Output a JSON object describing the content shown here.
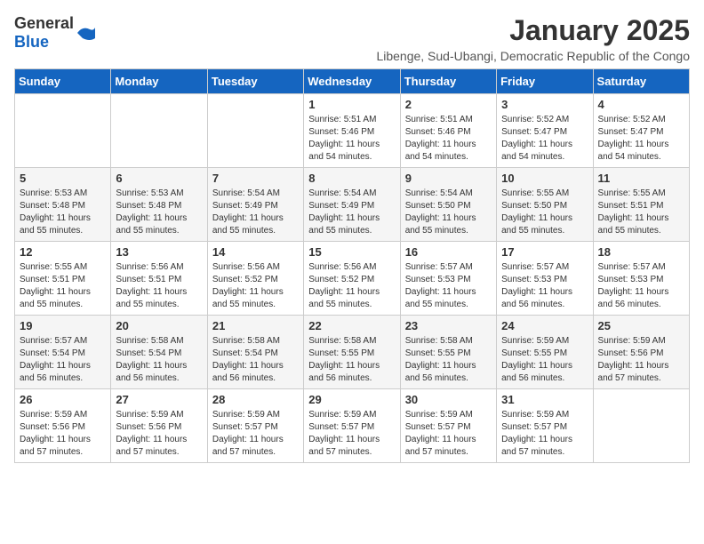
{
  "logo": {
    "general": "General",
    "blue": "Blue"
  },
  "title": "January 2025",
  "subtitle": "Libenge, Sud-Ubangi, Democratic Republic of the Congo",
  "headers": [
    "Sunday",
    "Monday",
    "Tuesday",
    "Wednesday",
    "Thursday",
    "Friday",
    "Saturday"
  ],
  "weeks": [
    [
      {
        "day": "",
        "info": ""
      },
      {
        "day": "",
        "info": ""
      },
      {
        "day": "",
        "info": ""
      },
      {
        "day": "1",
        "info": "Sunrise: 5:51 AM\nSunset: 5:46 PM\nDaylight: 11 hours and 54 minutes."
      },
      {
        "day": "2",
        "info": "Sunrise: 5:51 AM\nSunset: 5:46 PM\nDaylight: 11 hours and 54 minutes."
      },
      {
        "day": "3",
        "info": "Sunrise: 5:52 AM\nSunset: 5:47 PM\nDaylight: 11 hours and 54 minutes."
      },
      {
        "day": "4",
        "info": "Sunrise: 5:52 AM\nSunset: 5:47 PM\nDaylight: 11 hours and 54 minutes."
      }
    ],
    [
      {
        "day": "5",
        "info": "Sunrise: 5:53 AM\nSunset: 5:48 PM\nDaylight: 11 hours and 55 minutes."
      },
      {
        "day": "6",
        "info": "Sunrise: 5:53 AM\nSunset: 5:48 PM\nDaylight: 11 hours and 55 minutes."
      },
      {
        "day": "7",
        "info": "Sunrise: 5:54 AM\nSunset: 5:49 PM\nDaylight: 11 hours and 55 minutes."
      },
      {
        "day": "8",
        "info": "Sunrise: 5:54 AM\nSunset: 5:49 PM\nDaylight: 11 hours and 55 minutes."
      },
      {
        "day": "9",
        "info": "Sunrise: 5:54 AM\nSunset: 5:50 PM\nDaylight: 11 hours and 55 minutes."
      },
      {
        "day": "10",
        "info": "Sunrise: 5:55 AM\nSunset: 5:50 PM\nDaylight: 11 hours and 55 minutes."
      },
      {
        "day": "11",
        "info": "Sunrise: 5:55 AM\nSunset: 5:51 PM\nDaylight: 11 hours and 55 minutes."
      }
    ],
    [
      {
        "day": "12",
        "info": "Sunrise: 5:55 AM\nSunset: 5:51 PM\nDaylight: 11 hours and 55 minutes."
      },
      {
        "day": "13",
        "info": "Sunrise: 5:56 AM\nSunset: 5:51 PM\nDaylight: 11 hours and 55 minutes."
      },
      {
        "day": "14",
        "info": "Sunrise: 5:56 AM\nSunset: 5:52 PM\nDaylight: 11 hours and 55 minutes."
      },
      {
        "day": "15",
        "info": "Sunrise: 5:56 AM\nSunset: 5:52 PM\nDaylight: 11 hours and 55 minutes."
      },
      {
        "day": "16",
        "info": "Sunrise: 5:57 AM\nSunset: 5:53 PM\nDaylight: 11 hours and 55 minutes."
      },
      {
        "day": "17",
        "info": "Sunrise: 5:57 AM\nSunset: 5:53 PM\nDaylight: 11 hours and 56 minutes."
      },
      {
        "day": "18",
        "info": "Sunrise: 5:57 AM\nSunset: 5:53 PM\nDaylight: 11 hours and 56 minutes."
      }
    ],
    [
      {
        "day": "19",
        "info": "Sunrise: 5:57 AM\nSunset: 5:54 PM\nDaylight: 11 hours and 56 minutes."
      },
      {
        "day": "20",
        "info": "Sunrise: 5:58 AM\nSunset: 5:54 PM\nDaylight: 11 hours and 56 minutes."
      },
      {
        "day": "21",
        "info": "Sunrise: 5:58 AM\nSunset: 5:54 PM\nDaylight: 11 hours and 56 minutes."
      },
      {
        "day": "22",
        "info": "Sunrise: 5:58 AM\nSunset: 5:55 PM\nDaylight: 11 hours and 56 minutes."
      },
      {
        "day": "23",
        "info": "Sunrise: 5:58 AM\nSunset: 5:55 PM\nDaylight: 11 hours and 56 minutes."
      },
      {
        "day": "24",
        "info": "Sunrise: 5:59 AM\nSunset: 5:55 PM\nDaylight: 11 hours and 56 minutes."
      },
      {
        "day": "25",
        "info": "Sunrise: 5:59 AM\nSunset: 5:56 PM\nDaylight: 11 hours and 57 minutes."
      }
    ],
    [
      {
        "day": "26",
        "info": "Sunrise: 5:59 AM\nSunset: 5:56 PM\nDaylight: 11 hours and 57 minutes."
      },
      {
        "day": "27",
        "info": "Sunrise: 5:59 AM\nSunset: 5:56 PM\nDaylight: 11 hours and 57 minutes."
      },
      {
        "day": "28",
        "info": "Sunrise: 5:59 AM\nSunset: 5:57 PM\nDaylight: 11 hours and 57 minutes."
      },
      {
        "day": "29",
        "info": "Sunrise: 5:59 AM\nSunset: 5:57 PM\nDaylight: 11 hours and 57 minutes."
      },
      {
        "day": "30",
        "info": "Sunrise: 5:59 AM\nSunset: 5:57 PM\nDaylight: 11 hours and 57 minutes."
      },
      {
        "day": "31",
        "info": "Sunrise: 5:59 AM\nSunset: 5:57 PM\nDaylight: 11 hours and 57 minutes."
      },
      {
        "day": "",
        "info": ""
      }
    ]
  ]
}
